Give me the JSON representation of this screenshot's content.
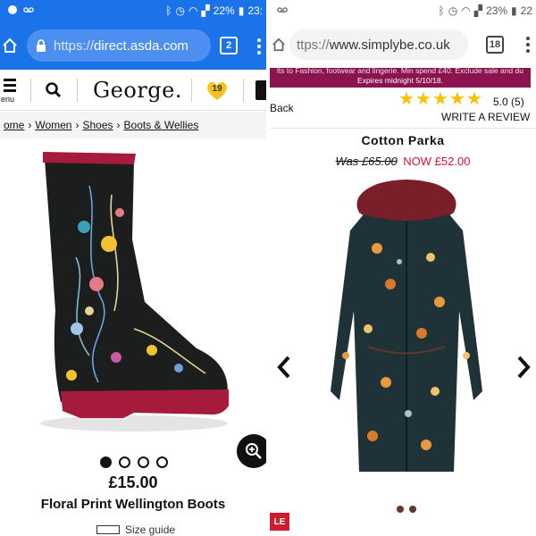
{
  "left": {
    "status": {
      "battery": "22%",
      "time": "23:"
    },
    "browser": {
      "url_protocol": "https://",
      "url_host": "direct.asda.com",
      "tab_count": "2"
    },
    "header": {
      "menu_label": "enu",
      "brand": "George.",
      "wishlist_count": "19"
    },
    "breadcrumb": [
      "ome",
      "Women",
      "Shoes",
      "Boots & Wellies"
    ],
    "product": {
      "image": "floral-wellington-boot",
      "carousel": {
        "total": 4,
        "active": 1
      },
      "price": "£15.00",
      "name": "Floral Print Wellington Boots",
      "size_guide_label": "Size guide"
    }
  },
  "right": {
    "status": {
      "battery": "23%",
      "time": "22"
    },
    "browser": {
      "url_protocol": "ttps://",
      "url_host": "www.simplybe.co.uk",
      "tab_count": "18"
    },
    "promo": {
      "line1": "lts to Fashion, footwear and lingerie. Min spend £40. Exclude sale and du",
      "line2": "Expires midnight 5/10/18."
    },
    "nav": {
      "back_label": "Back"
    },
    "rating": {
      "stars": 5,
      "score": "5.0",
      "count": "(5)",
      "write_review": "WRITE A REVIEW"
    },
    "product": {
      "title": "Cotton Parka",
      "was_price": "Was £65.00",
      "now_price": "NOW £52.00",
      "image": "floral-cotton-parka",
      "badge": "LE"
    }
  },
  "colors": {
    "chrome_blue": "#1a73e8",
    "promo_plum": "#8a1350",
    "sale_red": "#e01030",
    "star_gold": "#f4c300"
  }
}
